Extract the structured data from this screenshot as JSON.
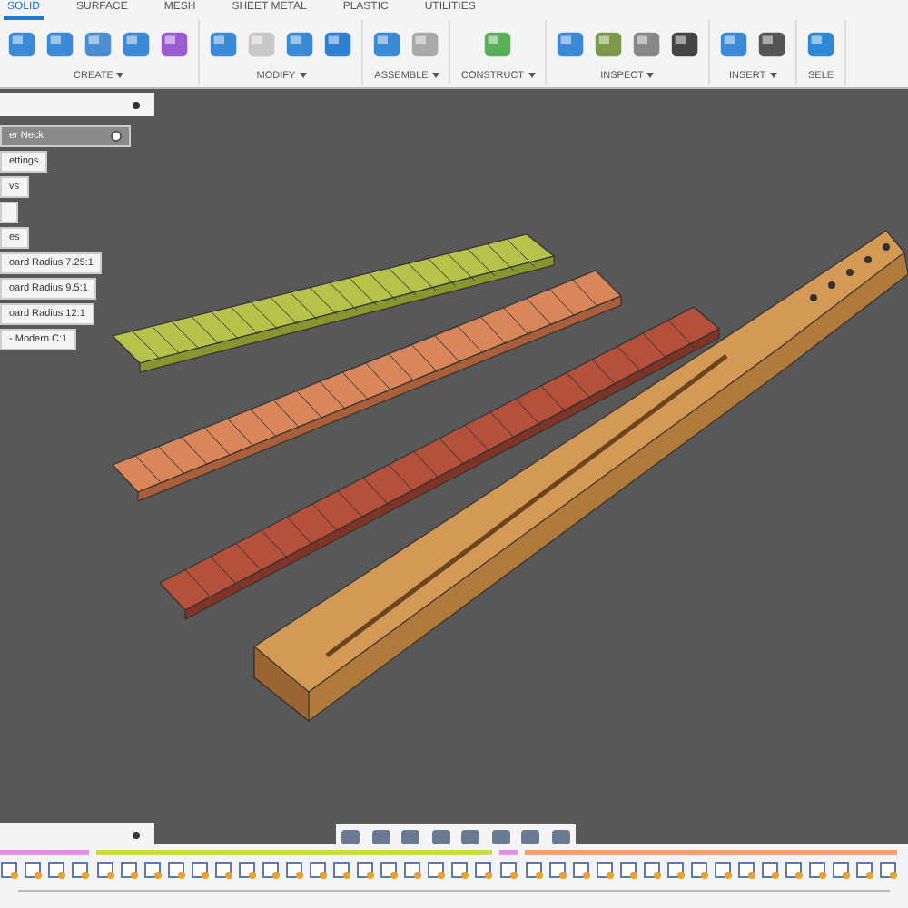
{
  "tabs": [
    {
      "label": "SOLID",
      "selected": true
    },
    {
      "label": "SURFACE",
      "selected": false
    },
    {
      "label": "MESH",
      "selected": false
    },
    {
      "label": "SHEET METAL",
      "selected": false
    },
    {
      "label": "PLASTIC",
      "selected": false
    },
    {
      "label": "UTILITIES",
      "selected": false
    }
  ],
  "toolbar_groups": [
    {
      "label": "CREATE",
      "dropdown": true
    },
    {
      "label": "MODIFY",
      "dropdown": true
    },
    {
      "label": "ASSEMBLE",
      "dropdown": true
    },
    {
      "label": "CONSTRUCT",
      "dropdown": true
    },
    {
      "label": "INSPECT",
      "dropdown": true
    },
    {
      "label": "INSERT",
      "dropdown": true
    },
    {
      "label": "SELE",
      "dropdown": false
    }
  ],
  "browser": {
    "items": [
      {
        "label": "er Neck",
        "selected": true
      },
      {
        "label": "ettings",
        "selected": false
      },
      {
        "label": "vs",
        "selected": false
      },
      {
        "selected": false
      },
      {
        "label": "es",
        "selected": false
      },
      {
        "label": "oard Radius 7.25:1",
        "selected": false
      },
      {
        "label": "oard Radius 9.5:1",
        "selected": false
      },
      {
        "label": "oard Radius 12:1",
        "selected": false
      },
      {
        "label": "- Modern C:1",
        "selected": false
      }
    ]
  }
}
